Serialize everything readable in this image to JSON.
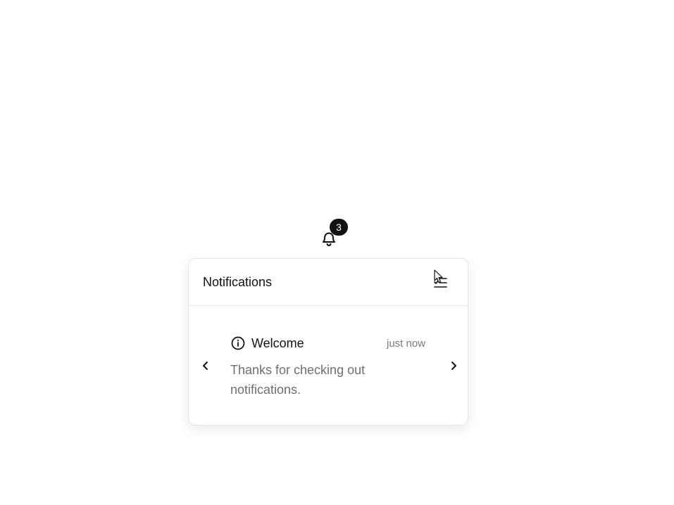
{
  "bell": {
    "icon": "bell-icon",
    "badge_count": "3"
  },
  "panel": {
    "title": "Notifications",
    "mark_read_icon": "mark-all-read-icon"
  },
  "notification": {
    "icon": "info-icon",
    "title": "Welcome",
    "time": "just now",
    "body": "Thanks for checking out notifications."
  },
  "nav": {
    "prev_icon": "chevron-left-icon",
    "next_icon": "chevron-right-icon"
  },
  "colors": {
    "badge_bg": "#111111",
    "border": "#e6e6e6",
    "muted_text": "#6f6f6f"
  }
}
